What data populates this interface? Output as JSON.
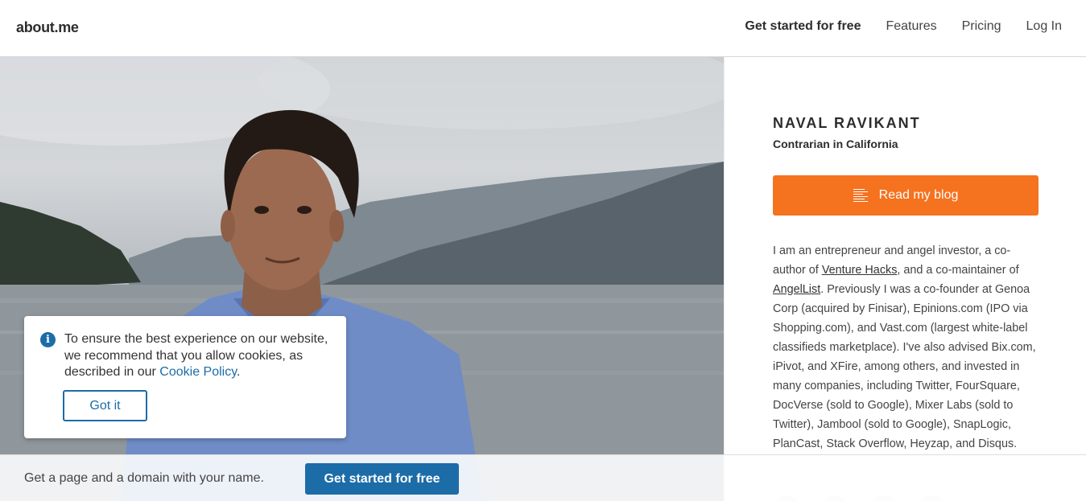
{
  "header": {
    "logo": "about.me",
    "nav": {
      "get_started": "Get started for free",
      "features": "Features",
      "pricing": "Pricing",
      "login": "Log In"
    }
  },
  "profile": {
    "name": "NAVAL RAVIKANT",
    "headline": "Contrarian in California",
    "blog_button": "Read my blog",
    "blog_icon": "document-lines-icon",
    "bio": {
      "p1": "I am an entrepreneur and angel investor, a co-author of ",
      "link1": "Venture Hacks",
      "p2": ", and a co-maintainer of ",
      "link2": "AngelList",
      "p3": ". Previously I was a co-founder at Genoa Corp (acquired by Finisar), Epinions.com (IPO via Shopping.com), and Vast.com (largest white-label classifieds marketplace). I've also advised Bix.com, iPivot, and XFire, among others, and invested in many companies, including Twitter, FourSquare, DocVerse (sold to Google), Mixer Labs (sold to Twitter), Jambool (sold to Google), SnapLogic, PlanCast, Stack Overflow, Heyzap, and Disqus."
    }
  },
  "cookie": {
    "icon": "info-icon",
    "text": "To ensure the best experience on our website, we recommend that you allow cookies, as described in our ",
    "link": "Cookie Policy",
    "period": ".",
    "button": "Got it"
  },
  "bottom_bar": {
    "text": "Get a page and a domain with your name.",
    "button": "Get started for free"
  },
  "colors": {
    "accent_orange": "#f5721f",
    "accent_blue": "#1c6ca8"
  }
}
